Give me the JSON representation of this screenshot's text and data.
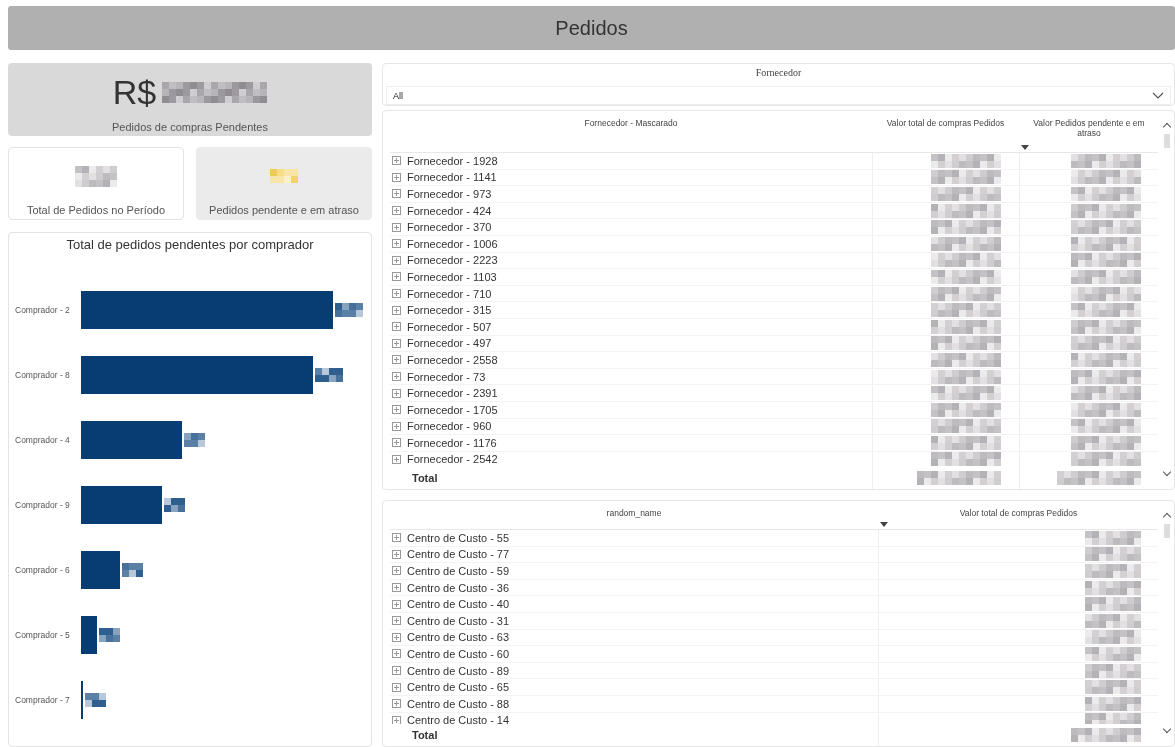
{
  "header": {
    "title": "Pedidos"
  },
  "kpis": [
    {
      "kind": "money",
      "prefix": "R$",
      "label": "Pedidos de compras Pendentes"
    },
    {
      "kind": "count",
      "label": "Total de Pedidos no Período"
    },
    {
      "kind": "alert",
      "label": "Pedidos pendente e em atraso"
    }
  ],
  "buyer_chart": {
    "title": "Total de pedidos pendentes por comprador",
    "buyers": [
      {
        "name": "Comprador - 2"
      },
      {
        "name": "Comprador - 8"
      },
      {
        "name": "Comprador - 4"
      },
      {
        "name": "Comprador - 9"
      },
      {
        "name": "Comprador - 6"
      },
      {
        "name": "Comprador - 5"
      },
      {
        "name": "Comprador - 7"
      }
    ]
  },
  "slicer": {
    "title": "Fornecedor",
    "value": "All"
  },
  "supplier_table": {
    "columns": [
      "Fornecedor - Mascarado",
      "Valor total de compras Pedidos",
      "Valor Pedidos pendente e em atraso"
    ],
    "rows": [
      "Fornecedor - 1928",
      "Fornecedor - 1141",
      "Fornecedor - 973",
      "Fornecedor - 424",
      "Fornecedor - 370",
      "Fornecedor - 1006",
      "Fornecedor - 2223",
      "Fornecedor - 1103",
      "Fornecedor - 710",
      "Fornecedor - 315",
      "Fornecedor - 507",
      "Fornecedor - 497",
      "Fornecedor - 2558",
      "Fornecedor - 73",
      "Fornecedor - 2391",
      "Fornecedor - 1705",
      "Fornecedor - 960",
      "Fornecedor - 1176",
      "Fornecedor - 2542"
    ],
    "total": "Total"
  },
  "cost_table": {
    "columns": [
      "random_name",
      "Valor total de compras Pedidos"
    ],
    "rows": [
      "Centro de Custo - 55",
      "Centro de Custo - 77",
      "Centro de Custo - 59",
      "Centro de Custo - 36",
      "Centro de Custo - 40",
      "Centro de Custo - 31",
      "Centro de Custo - 63",
      "Centro de Custo - 60",
      "Centro de Custo - 89",
      "Centro de Custo - 65",
      "Centro de Custo - 88",
      "Centro de Custo - 14"
    ],
    "total": "Total"
  }
}
